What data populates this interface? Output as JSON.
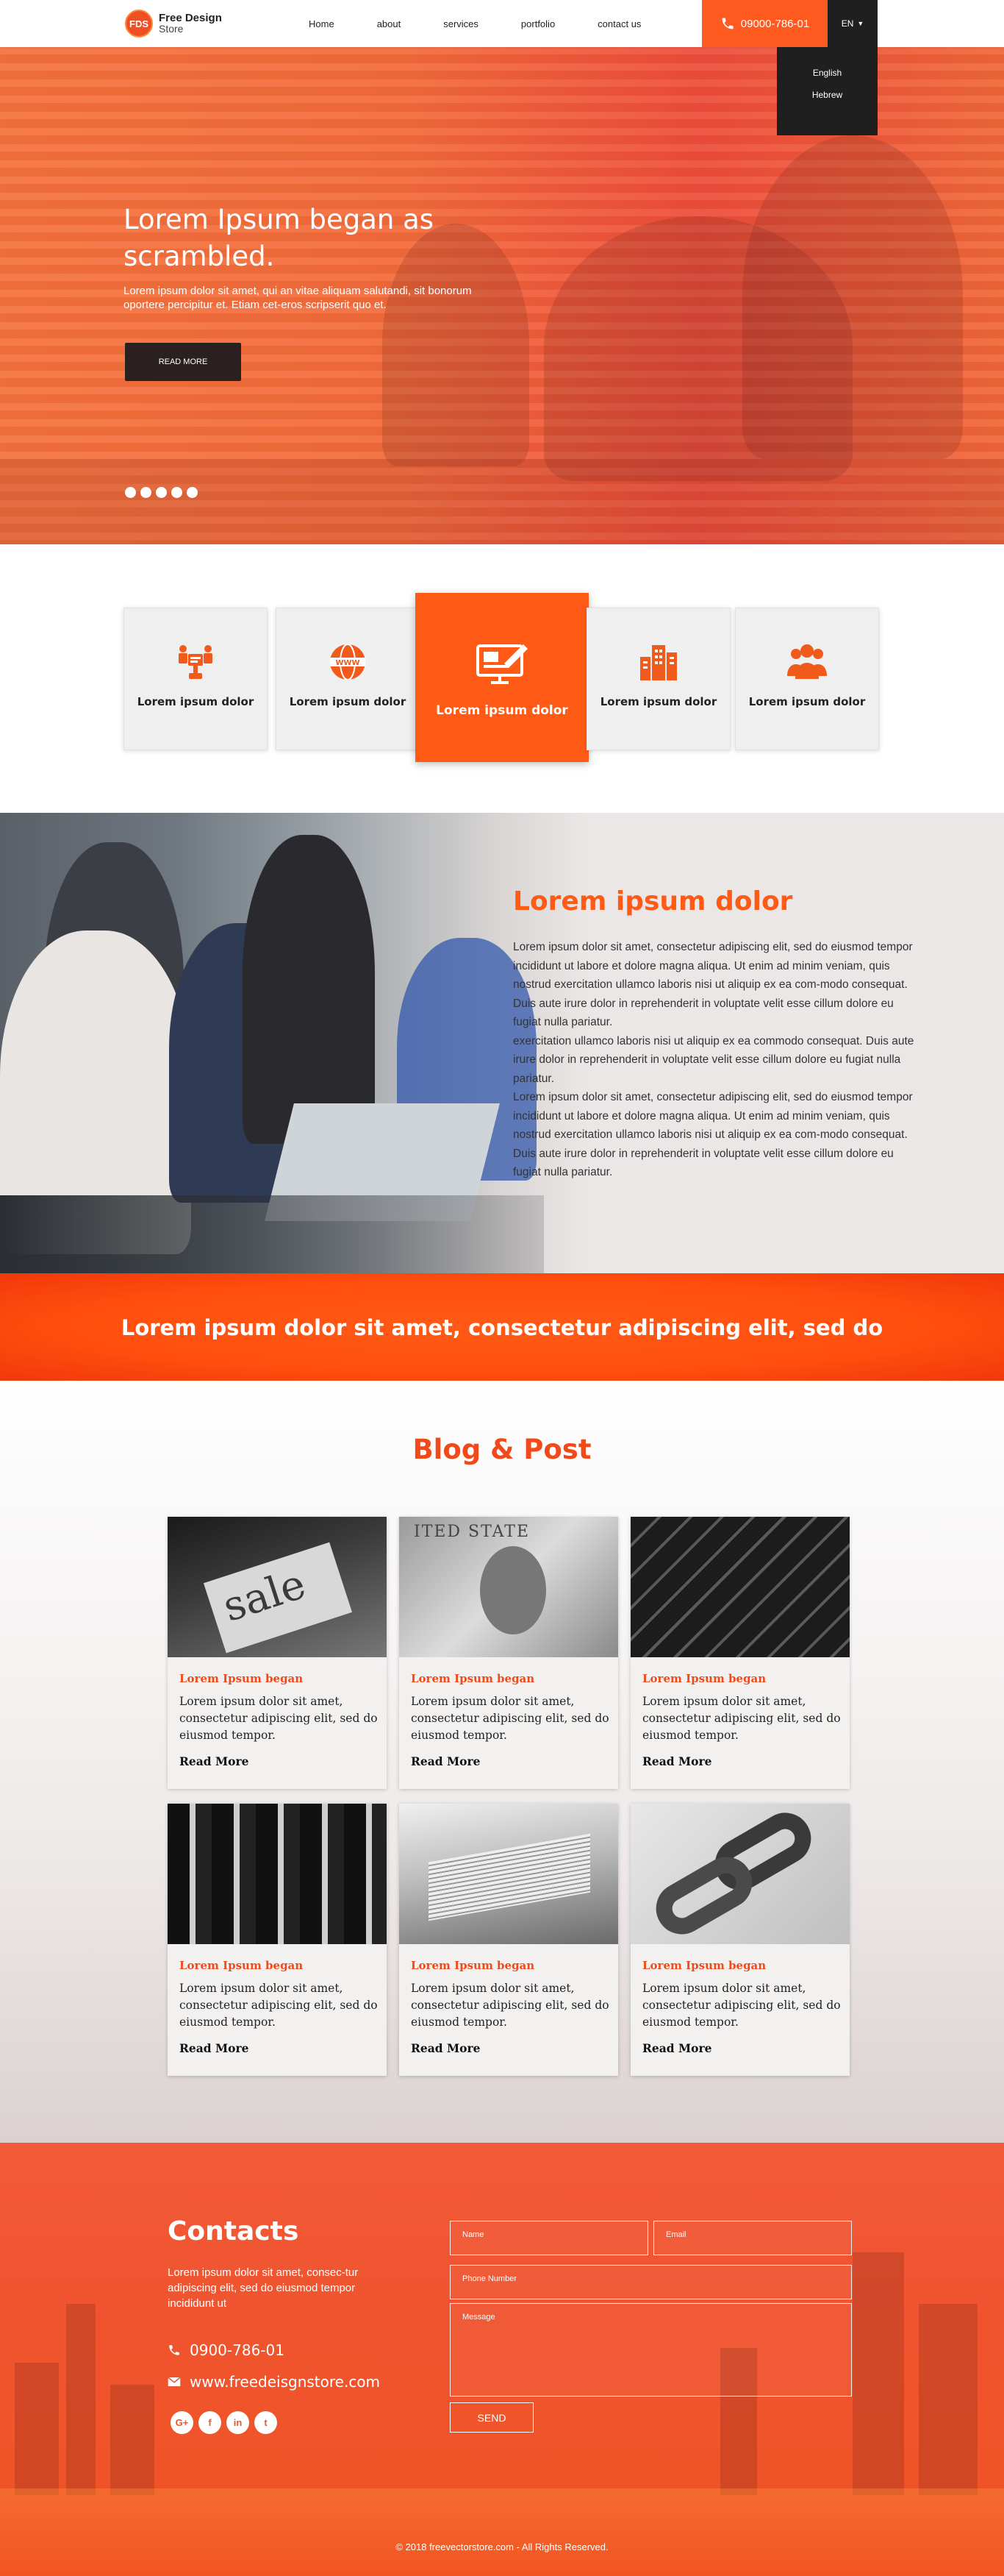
{
  "header": {
    "logo_badge": "FDS",
    "logo_line1": "Free Design",
    "logo_line2": "Store",
    "nav": [
      "Home",
      "about",
      "services",
      "portfolio",
      "contact us"
    ],
    "phone": "09000-786-01",
    "lang": "EN",
    "lang_options": [
      "English",
      "Hebrew"
    ]
  },
  "hero": {
    "title": "Lorem Ipsum began as scrambled.",
    "text": "Lorem ipsum dolor sit amet, qui an vitae aliquam salutandi, sit bonorum oportere percipitur et. Etiam cet-eros scripserit quo et.",
    "button": "READ MORE",
    "slides": 5
  },
  "services": {
    "items": [
      {
        "label": "Lorem ipsum dolor",
        "icon": "team-structure-icon"
      },
      {
        "label": "Lorem ipsum dolor",
        "icon": "www-globe-icon"
      },
      {
        "label": "Lorem ipsum dolor",
        "icon": "design-monitor-icon",
        "active": true
      },
      {
        "label": "Lorem ipsum dolor",
        "icon": "buildings-icon"
      },
      {
        "label": "Lorem ipsum dolor",
        "icon": "group-icon"
      }
    ]
  },
  "about": {
    "title": "Lorem ipsum dolor",
    "p1": "Lorem ipsum dolor sit amet, consectetur adipiscing elit, sed do eiusmod tempor incididunt ut labore et dolore magna aliqua. Ut enim ad minim veniam, quis nostrud exercitation ullamco laboris nisi ut aliquip ex ea com-modo consequat. Duis aute irure dolor in reprehenderit in voluptate velit esse cillum dolore eu fugiat nulla pariatur.",
    "p2": "exercitation ullamco laboris nisi ut aliquip ex ea commodo consequat. Duis aute irure dolor in reprehenderit in voluptate velit esse cillum dolore eu fugiat nulla pariatur.",
    "p3": "Lorem ipsum dolor sit amet, consectetur adipiscing elit, sed do eiusmod tempor incididunt ut labore et dolore magna aliqua. Ut enim ad minim veniam, quis nostrud exercitation ullamco laboris nisi ut aliquip ex ea com-modo consequat. Duis aute irure dolor in reprehenderit in voluptate velit esse cillum dolore eu fugiat nulla pariatur."
  },
  "banner": {
    "text": "Lorem ipsum dolor sit amet, consectetur adipiscing elit, sed do"
  },
  "blog": {
    "title": "Blog & Post",
    "cards": [
      {
        "category": "Lorem Ipsum began",
        "text": "Lorem ipsum dolor sit amet, consectetur adipiscing elit, sed do eiusmod tempor.",
        "link": "Read More",
        "image": "sale"
      },
      {
        "category": "Lorem Ipsum began",
        "text": "Lorem ipsum dolor sit amet, consectetur adipiscing elit, sed do eiusmod tempor.",
        "link": "Read More",
        "image": "dollar"
      },
      {
        "category": "Lorem Ipsum began",
        "text": "Lorem ipsum dolor sit amet, consectetur adipiscing elit, sed do eiusmod tempor.",
        "link": "Read More",
        "image": "keyboard"
      },
      {
        "category": "Lorem Ipsum began",
        "text": "Lorem ipsum dolor sit amet, consectetur adipiscing elit, sed do eiusmod tempor.",
        "link": "Read More",
        "image": "escalator"
      },
      {
        "category": "Lorem Ipsum began",
        "text": "Lorem ipsum dolor sit amet, consectetur adipiscing elit, sed do eiusmod tempor.",
        "link": "Read More",
        "image": "cards"
      },
      {
        "category": "Lorem Ipsum began",
        "text": "Lorem ipsum dolor sit amet, consectetur adipiscing elit, sed do eiusmod tempor.",
        "link": "Read More",
        "image": "chain"
      }
    ]
  },
  "contact": {
    "title": "Contacts",
    "text": "Lorem ipsum dolor sit amet, consec-tur adipiscing elit, sed do eiusmod tempor incididunt ut",
    "phone": "0900-786-01",
    "website": "www.freedeisgnstore.com",
    "socials": [
      "G+",
      "f",
      "in",
      "t"
    ],
    "form": {
      "name_placeholder": "Name",
      "email_placeholder": "Email",
      "phone_placeholder": "Phone Number",
      "message_placeholder": "Message",
      "send": "SEND"
    },
    "copyright": "© 2018 freevectorstore.com - All Rights Reserved."
  },
  "colors": {
    "accent": "#ff5a16",
    "dark": "#1f1f1f"
  }
}
